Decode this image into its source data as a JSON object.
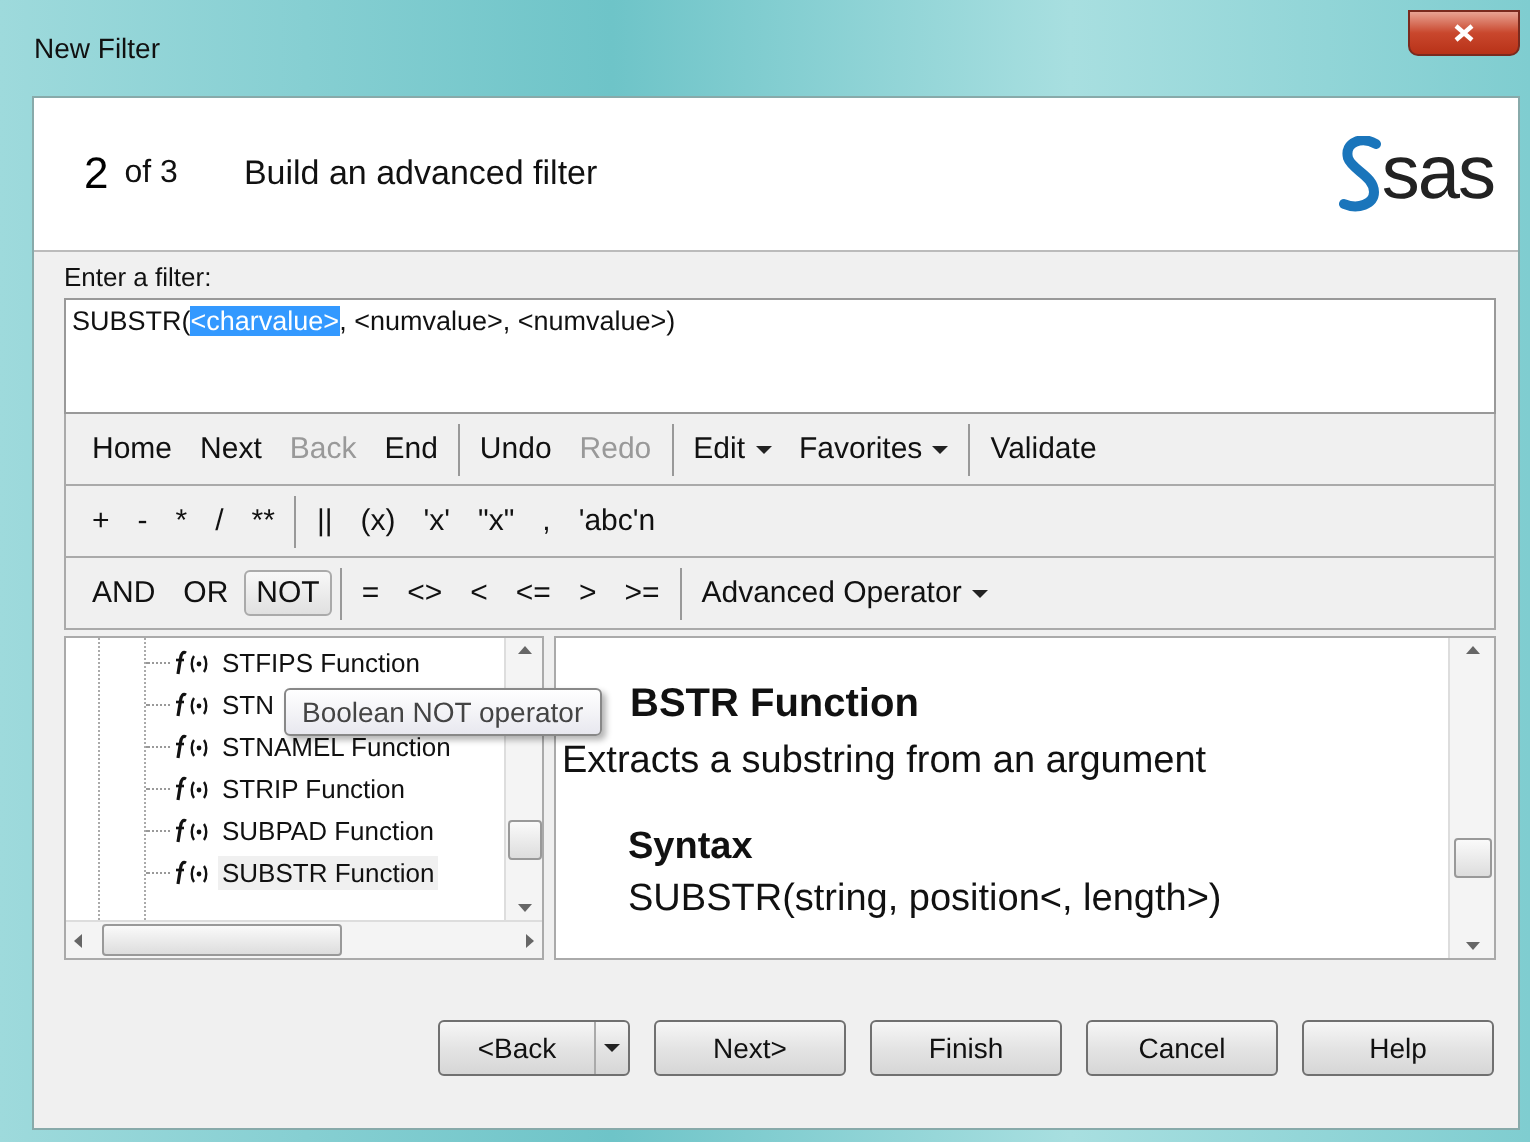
{
  "window": {
    "title": "New Filter"
  },
  "header": {
    "step": "2",
    "of": "of 3",
    "title": "Build an advanced filter",
    "logo": "sas"
  },
  "filter": {
    "label": "Enter a filter:",
    "prefix": "SUBSTR(",
    "selection": "<charvalue>",
    "suffix": ", <numvalue>, <numvalue>)"
  },
  "toolbars": [
    [
      [
        {
          "label": "Home",
          "kind": "button",
          "disabled": false,
          "pressed": false
        },
        {
          "label": "Next",
          "kind": "button",
          "disabled": false,
          "pressed": false
        },
        {
          "label": "Back",
          "kind": "button",
          "disabled": true,
          "pressed": false
        },
        {
          "label": "End",
          "kind": "button",
          "disabled": false,
          "pressed": false
        }
      ],
      [
        {
          "label": "Undo",
          "kind": "button",
          "disabled": false,
          "pressed": false
        },
        {
          "label": "Redo",
          "kind": "button",
          "disabled": true,
          "pressed": false
        }
      ],
      [
        {
          "label": "Edit",
          "kind": "menu",
          "disabled": false,
          "pressed": false
        },
        {
          "label": "Favorites",
          "kind": "menu",
          "disabled": false,
          "pressed": false
        }
      ],
      [
        {
          "label": "Validate",
          "kind": "button",
          "disabled": false,
          "pressed": false
        }
      ]
    ],
    [
      [
        {
          "label": "+",
          "kind": "button",
          "disabled": false,
          "pressed": false
        },
        {
          "label": "-",
          "kind": "button",
          "disabled": false,
          "pressed": false
        },
        {
          "label": "*",
          "kind": "button",
          "disabled": false,
          "pressed": false
        },
        {
          "label": "/",
          "kind": "button",
          "disabled": false,
          "pressed": false
        },
        {
          "label": "**",
          "kind": "button",
          "disabled": false,
          "pressed": false
        }
      ],
      [
        {
          "label": "||",
          "kind": "button",
          "disabled": false,
          "pressed": false
        },
        {
          "label": "(x)",
          "kind": "button",
          "disabled": false,
          "pressed": false
        },
        {
          "label": "'x'",
          "kind": "button",
          "disabled": false,
          "pressed": false
        },
        {
          "label": "\"x\"",
          "kind": "button",
          "disabled": false,
          "pressed": false
        },
        {
          "label": ",",
          "kind": "button",
          "disabled": false,
          "pressed": false
        },
        {
          "label": "'abc'n",
          "kind": "button",
          "disabled": false,
          "pressed": false
        }
      ]
    ],
    [
      [
        {
          "label": "AND",
          "kind": "button",
          "disabled": false,
          "pressed": false
        },
        {
          "label": "OR",
          "kind": "button",
          "disabled": false,
          "pressed": false
        },
        {
          "label": "NOT",
          "kind": "button",
          "disabled": false,
          "pressed": true
        }
      ],
      [
        {
          "label": "=",
          "kind": "button",
          "disabled": false,
          "pressed": false
        },
        {
          "label": "<>",
          "kind": "button",
          "disabled": false,
          "pressed": false
        },
        {
          "label": "<",
          "kind": "button",
          "disabled": false,
          "pressed": false
        },
        {
          "label": "<=",
          "kind": "button",
          "disabled": false,
          "pressed": false
        },
        {
          "label": ">",
          "kind": "button",
          "disabled": false,
          "pressed": false
        },
        {
          "label": ">=",
          "kind": "button",
          "disabled": false,
          "pressed": false
        }
      ],
      [
        {
          "label": "Advanced Operator",
          "kind": "menu",
          "disabled": false,
          "pressed": false
        }
      ]
    ]
  ],
  "tree": {
    "items": [
      {
        "label": "STFIPS Function",
        "selected": false
      },
      {
        "label": "STN",
        "selected": false
      },
      {
        "label": "STNAMEL Function",
        "selected": false
      },
      {
        "label": "STRIP Function",
        "selected": false
      },
      {
        "label": "SUBPAD Function",
        "selected": false
      },
      {
        "label": "SUBSTR Function",
        "selected": true
      }
    ]
  },
  "tooltip": "Boolean NOT operator",
  "help": {
    "heading": "BSTR Function",
    "description": "Extracts a substring from an argument",
    "syntax_heading": "Syntax",
    "syntax": "SUBSTR(string, position<, length>)"
  },
  "buttons": [
    {
      "label": "<Back",
      "kind": "split"
    },
    {
      "label": "Next>",
      "kind": "plain"
    },
    {
      "label": "Finish",
      "kind": "plain"
    },
    {
      "label": "Cancel",
      "kind": "plain"
    },
    {
      "label": "Help",
      "kind": "plain"
    }
  ]
}
